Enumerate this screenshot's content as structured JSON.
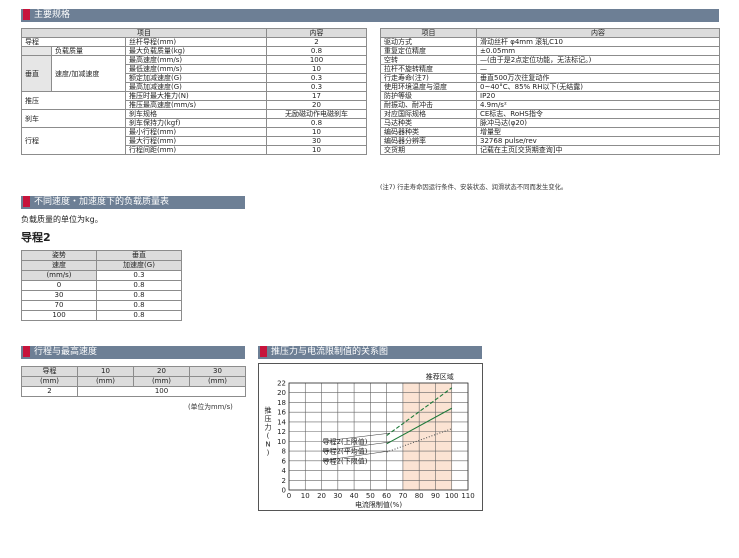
{
  "sections": {
    "main_spec": "主要规格",
    "payload": "不同速度・加速度下的负载质量表",
    "stroke_speed": "行程与最高速度",
    "thrust": "推压力与电流限制值的关系图"
  },
  "left_table": {
    "header": {
      "item": "项目",
      "content": "内容"
    },
    "rows": {
      "lead_group": "导程",
      "lead_item": "丝杆导程(mm)",
      "lead_val": "2",
      "payload_group": "负载质量",
      "payload_item": "最大负载质量(kg)",
      "payload_val": "0.8",
      "vertical_group": "垂直",
      "speed_group": "速度/加减速度",
      "max_speed_item": "最高速度(mm/s)",
      "max_speed_val": "100",
      "min_speed_item": "最低速度(mm/s)",
      "min_speed_val": "10",
      "rated_acc_item": "额定加减速度(G)",
      "rated_acc_val": "0.3",
      "max_acc_item": "最高加减速度(G)",
      "max_acc_val": "0.3",
      "push_group": "推压",
      "push_force_item": "推压时最大推力(N)",
      "push_force_val": "17",
      "push_speed_item": "推压最高速度(mm/s)",
      "push_speed_val": "20",
      "brake_group": "刹车",
      "brake_spec_item": "刹车规格",
      "brake_spec_val": "无励磁动作电磁刹车",
      "brake_hold_item": "刹车保持力(kgf)",
      "brake_hold_val": "0.8",
      "stroke_group": "行程",
      "min_stroke_item": "最小行程(mm)",
      "min_stroke_val": "10",
      "max_stroke_item": "最大行程(mm)",
      "max_stroke_val": "30",
      "stroke_pitch_item": "行程间距(mm)",
      "stroke_pitch_val": "10"
    }
  },
  "right_table": {
    "header": {
      "item": "项目",
      "content": "内容"
    },
    "rows": [
      {
        "item": "驱动方式",
        "value": "滑动丝杆 φ4mm 滚轧C10"
      },
      {
        "item": "重复定位精度",
        "value": "±0.05mm"
      },
      {
        "item": "空转",
        "value": "—(由于是2点定位功能，无法标记。)"
      },
      {
        "item": "拉杆不旋转精度",
        "value": "—"
      },
      {
        "item": "行走寿命(注7)",
        "value": "垂直500万次往复动作"
      },
      {
        "item": "使用环境温度与湿度",
        "value": "0~40°C、85% RH以下(无结露)"
      },
      {
        "item": "防护等级",
        "value": "IP20"
      },
      {
        "item": "耐振动、耐冲击",
        "value": "4.9m/s²"
      },
      {
        "item": "对应国际规格",
        "value": "CE标志、RoHS指令"
      },
      {
        "item": "马达种类",
        "value": "脉冲马达(φ20)"
      },
      {
        "item": "编码器种类",
        "value": "增量型"
      },
      {
        "item": "编码器分辨率",
        "value": "32768 pulse/rev"
      },
      {
        "item": "交货期",
        "value": "记载在主页[交货期查询]中"
      }
    ],
    "note": "(注7) 行走寿命因运行条件、安装状态、润滑状态不同而发生变化。"
  },
  "payload_note": "负载质量的单位为kg。",
  "payload_heading": "导程2",
  "payload_table": {
    "posture": "姿势",
    "vertical": "垂直",
    "speed": "速度",
    "accel": "加速度(G)",
    "unit": "(mm/s)",
    "accel_val": "0.3",
    "rows": [
      {
        "speed": "0",
        "value": "0.8"
      },
      {
        "speed": "30",
        "value": "0.8"
      },
      {
        "speed": "70",
        "value": "0.8"
      },
      {
        "speed": "100",
        "value": "0.8"
      }
    ]
  },
  "stroke_table": {
    "h_lead": "导程",
    "h_lead_unit": "(mm)",
    "strokes": [
      "10",
      "20",
      "30"
    ],
    "stroke_unit": "(mm)",
    "lead": "2",
    "speed": "100",
    "unit_note": "(单位为mm/s)"
  },
  "chart_data": {
    "type": "line",
    "xlabel": "电流限制值(%)",
    "ylabel": "推压力(N)",
    "xlim": [
      0,
      110
    ],
    "ylim": [
      0,
      22
    ],
    "xticks": [
      "0",
      "10",
      "20",
      "30",
      "40",
      "50",
      "60",
      "70",
      "80",
      "90",
      "100",
      "110"
    ],
    "yticks": [
      "0",
      "2",
      "4",
      "6",
      "8",
      "10",
      "12",
      "14",
      "16",
      "18",
      "20",
      "22"
    ],
    "recommended_label": "推荐区域",
    "recommended_range": [
      70,
      100
    ],
    "series": [
      {
        "name": "导程2(上限值)",
        "x": [
          60,
          100
        ],
        "y": [
          11.2,
          21.0
        ],
        "style": "dashed",
        "color": "#1f7a3a"
      },
      {
        "name": "导程2(平均值)",
        "x": [
          60,
          100
        ],
        "y": [
          9.5,
          16.8
        ],
        "style": "solid",
        "color": "#1f7a3a"
      },
      {
        "name": "导程2(下限值)",
        "x": [
          60,
          100
        ],
        "y": [
          7.8,
          12.6
        ],
        "style": "dotted",
        "color": "#555555"
      }
    ],
    "colors": {
      "recommended_fill": "#fbe3d3",
      "grid": "#666666"
    }
  }
}
